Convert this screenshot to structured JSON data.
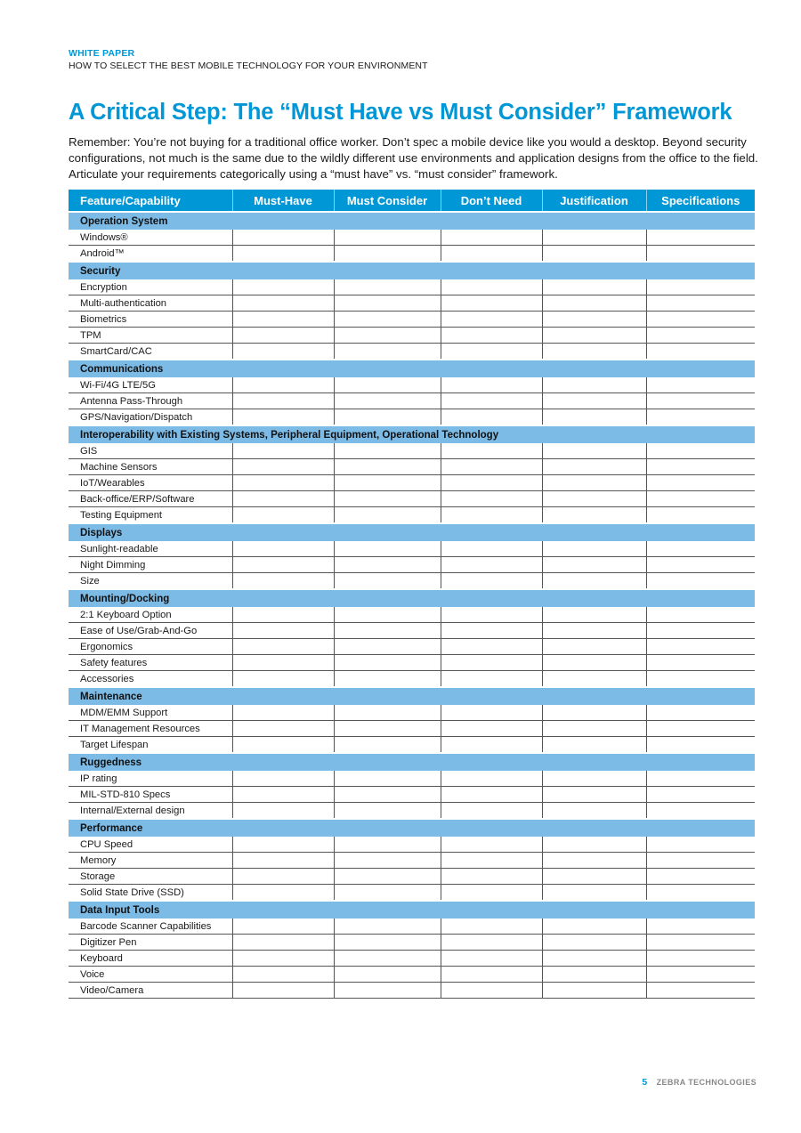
{
  "header": {
    "eyebrow": "WHITE PAPER",
    "subtitle": "HOW TO SELECT THE BEST MOBILE TECHNOLOGY FOR YOUR ENVIRONMENT"
  },
  "title": "A Critical Step: The “Must Have vs Must Consider” Framework",
  "intro": "Remember: You’re not buying for a traditional office worker. Don’t spec a mobile device like you would a desktop. Beyond security configurations, not much is the same due to the wildly different use environments and application designs from the office to the field. Articulate your requirements categorically using a “must have” vs. “must consider” framework.",
  "table": {
    "columns": [
      "Feature/Capability",
      "Must-Have",
      "Must Consider",
      "Don’t Need",
      "Justification",
      "Specifications"
    ],
    "sections": [
      {
        "name": "Operation System",
        "items": [
          "Windows®",
          "Android™"
        ]
      },
      {
        "name": "Security",
        "items": [
          "Encryption",
          "Multi-authentication",
          "Biometrics",
          "TPM",
          "SmartCard/CAC"
        ]
      },
      {
        "name": "Communications",
        "items": [
          "Wi-Fi/4G LTE/5G",
          "Antenna Pass-Through",
          "GPS/Navigation/Dispatch"
        ]
      },
      {
        "name": "Interoperability with Existing Systems, Peripheral Equipment, Operational Technology",
        "items": [
          "GIS",
          "Machine Sensors",
          "IoT/Wearables",
          "Back-office/ERP/Software",
          "Testing Equipment"
        ]
      },
      {
        "name": "Displays",
        "items": [
          "Sunlight-readable",
          "Night Dimming",
          "Size"
        ]
      },
      {
        "name": "Mounting/Docking",
        "items": [
          "2:1 Keyboard Option",
          "Ease of Use/Grab-And-Go",
          "Ergonomics",
          "Safety features",
          "Accessories"
        ]
      },
      {
        "name": "Maintenance",
        "items": [
          "MDM/EMM Support",
          "IT Management Resources",
          "Target Lifespan"
        ]
      },
      {
        "name": "Ruggedness",
        "items": [
          "IP rating",
          "MIL-STD-810 Specs",
          "Internal/External design"
        ]
      },
      {
        "name": "Performance",
        "items": [
          "CPU Speed",
          "Memory",
          "Storage",
          "Solid State Drive (SSD)"
        ]
      },
      {
        "name": "Data Input Tools",
        "items": [
          "Barcode Scanner Capabilities",
          "Digitizer Pen",
          "Keyboard",
          "Voice",
          "Video/Camera"
        ]
      }
    ]
  },
  "footer": {
    "page_number": "5",
    "brand": "ZEBRA TECHNOLOGIES"
  },
  "colors": {
    "brand_blue": "#0097d6",
    "section_blue": "#7dbbe7"
  }
}
